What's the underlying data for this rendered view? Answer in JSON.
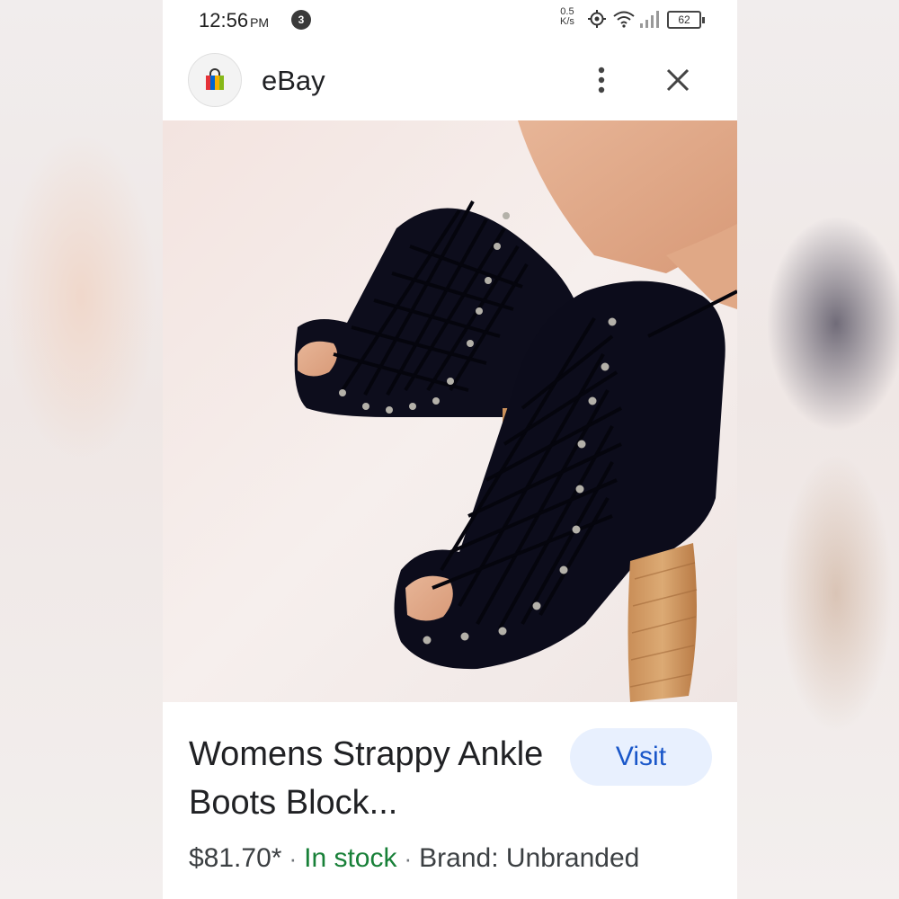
{
  "status_bar": {
    "time": "12:56",
    "ampm": "PM",
    "notification_count": "3",
    "net_speed_value": "0.5",
    "net_speed_unit": "K/s",
    "battery": "62"
  },
  "header": {
    "site_name": "eBay",
    "icons": [
      "shopping-bag-icon",
      "more-vert-icon",
      "close-icon"
    ]
  },
  "product": {
    "image": "black lace-up peep-toe ankle boots with wooden block heel",
    "title": "Womens Strappy Ankle Boots Block...",
    "price": "$81.70*",
    "availability": "In stock",
    "brand": "Brand: Unbranded",
    "visit_label": "Visit"
  },
  "colors": {
    "visit_bg": "#e8f0fe",
    "visit_text": "#1a57c9",
    "in_stock": "#188038"
  }
}
